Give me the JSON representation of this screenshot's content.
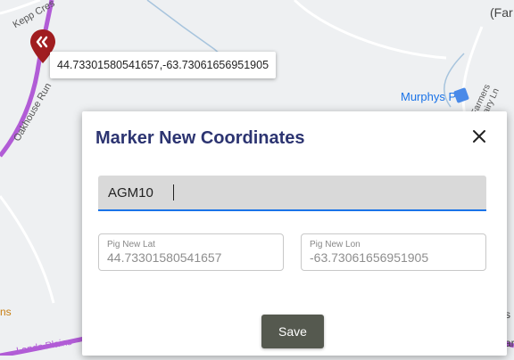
{
  "map": {
    "road_labels": [
      "Kepp Cres",
      "Oakhouse Run",
      "Farmers Dairy Ln",
      "Lands Plains"
    ],
    "partial_labels": [
      "(Far",
      "ns",
      "s",
      "ar"
    ],
    "poi": "Murphys Pit",
    "marker_tooltip": "44.73301580541657,-63.73061656951905",
    "colors": {
      "route": "#b15cd6",
      "water_line": "#a7c4dd",
      "marker": "#a01d20"
    }
  },
  "dialog": {
    "title": "Marker New Coordinates",
    "name_value": "AGM10",
    "lat_label": "Pig New Lat",
    "lat_value": "44.73301580541657",
    "lon_label": "Pig New Lon",
    "lon_value": "-63.73061656951905",
    "save_label": "Save",
    "colors": {
      "title": "#2c3471",
      "focus": "#1a73e8",
      "save_bg": "#55594f"
    }
  }
}
